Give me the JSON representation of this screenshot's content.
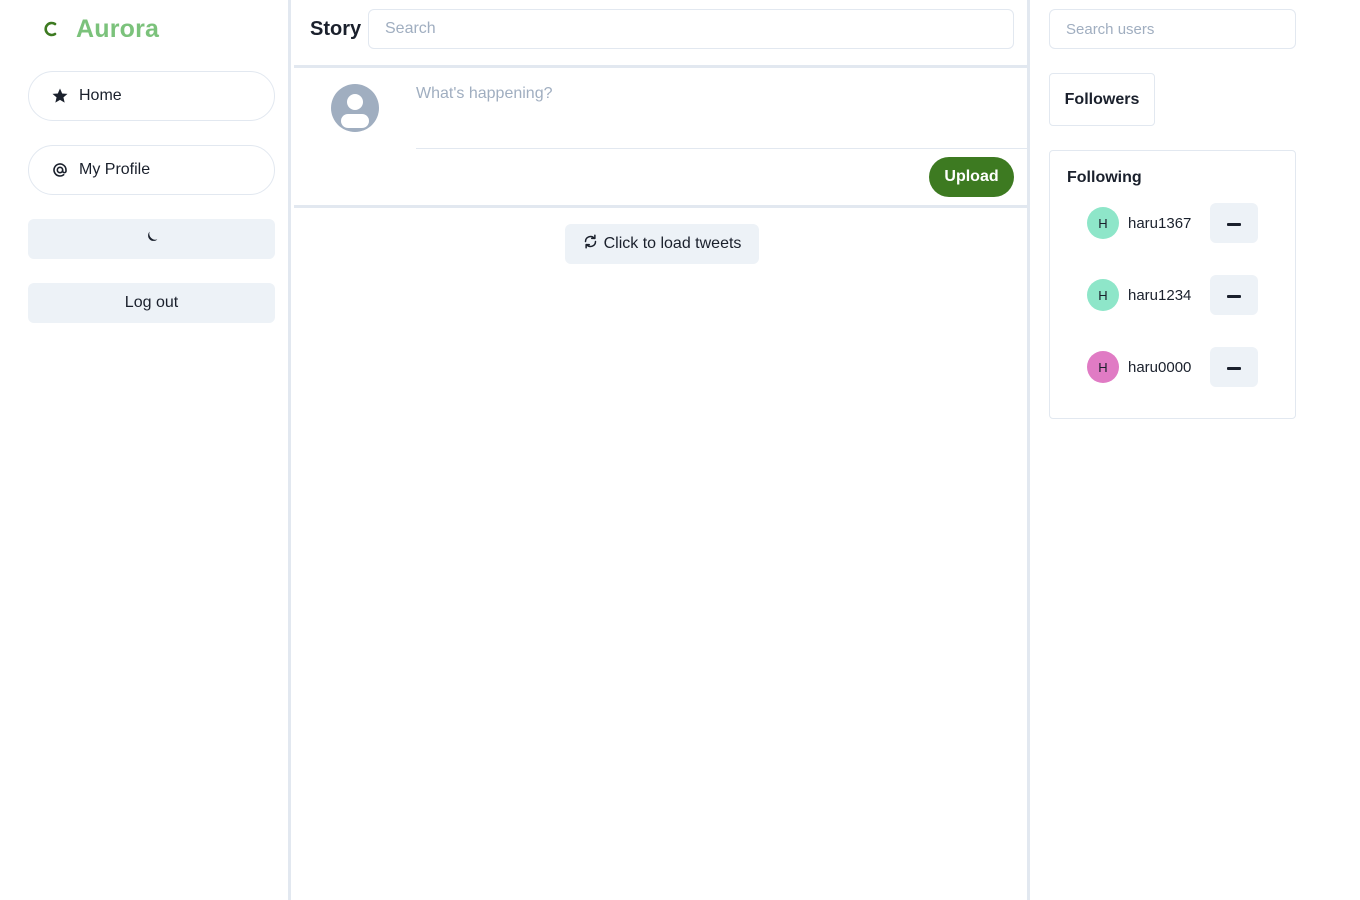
{
  "sidebar": {
    "brand": {
      "name": "Aurora",
      "icon": "crescent-spinner-icon",
      "color": "#7bc27b",
      "icon_color": "#3d7a21"
    },
    "nav": [
      {
        "label": "Home",
        "icon": "star-icon"
      },
      {
        "label": "My Profile",
        "icon": "at-sign-icon"
      }
    ],
    "theme_toggle": {
      "icon": "moon-icon"
    },
    "logout_label": "Log out"
  },
  "main": {
    "title": "Story",
    "search_placeholder": "Search",
    "compose": {
      "placeholder": "What's happening?",
      "upload_label": "Upload",
      "upload_color": "#3d7a21"
    },
    "load_tweets_label": "Click to load tweets",
    "load_tweets_icon": "refresh-icon"
  },
  "right": {
    "search_users_placeholder": "Search users",
    "followers_label": "Followers",
    "following_title": "Following",
    "following": [
      {
        "initial": "H",
        "username": "haru1367",
        "avatar_color": "#8ee6c9"
      },
      {
        "initial": "H",
        "username": "haru1234",
        "avatar_color": "#8ee6c9"
      },
      {
        "initial": "H",
        "username": "haru0000",
        "avatar_color": "#e07bc4"
      }
    ],
    "unfollow_icon": "minus-icon"
  }
}
